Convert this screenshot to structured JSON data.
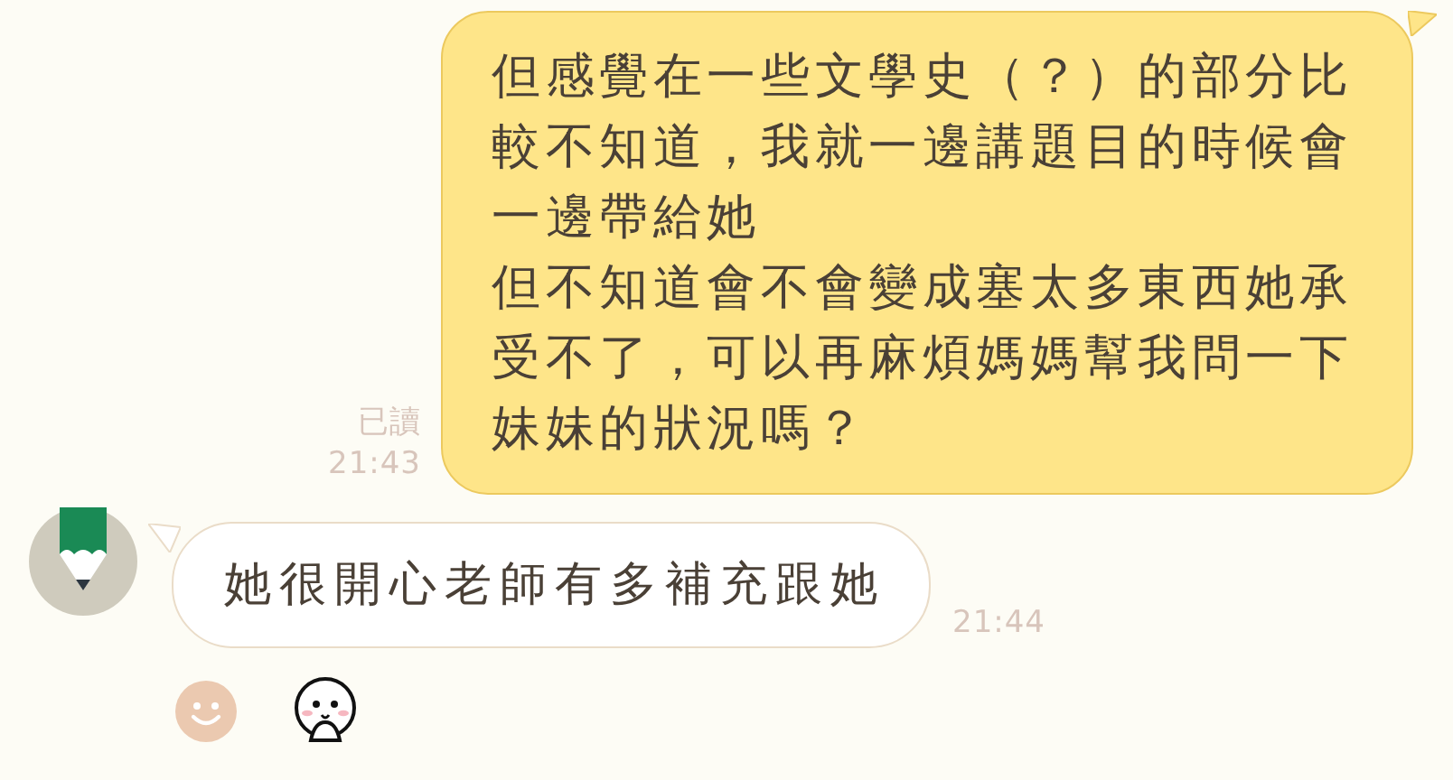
{
  "messages": [
    {
      "kind": "sent",
      "paragraphs": [
        "但感覺在一些文學史（？）的部分比較不知道，我就一邊講題目的時候會一邊帶給她",
        "但不知道會不會變成塞太多東西她承受不了，可以再麻煩媽媽幫我問一下妹妹的狀況嗎？"
      ],
      "read_label": "已讀",
      "time": "21:43"
    },
    {
      "kind": "received",
      "text": "她很開心老師有多補充跟她",
      "time": "21:44"
    }
  ]
}
